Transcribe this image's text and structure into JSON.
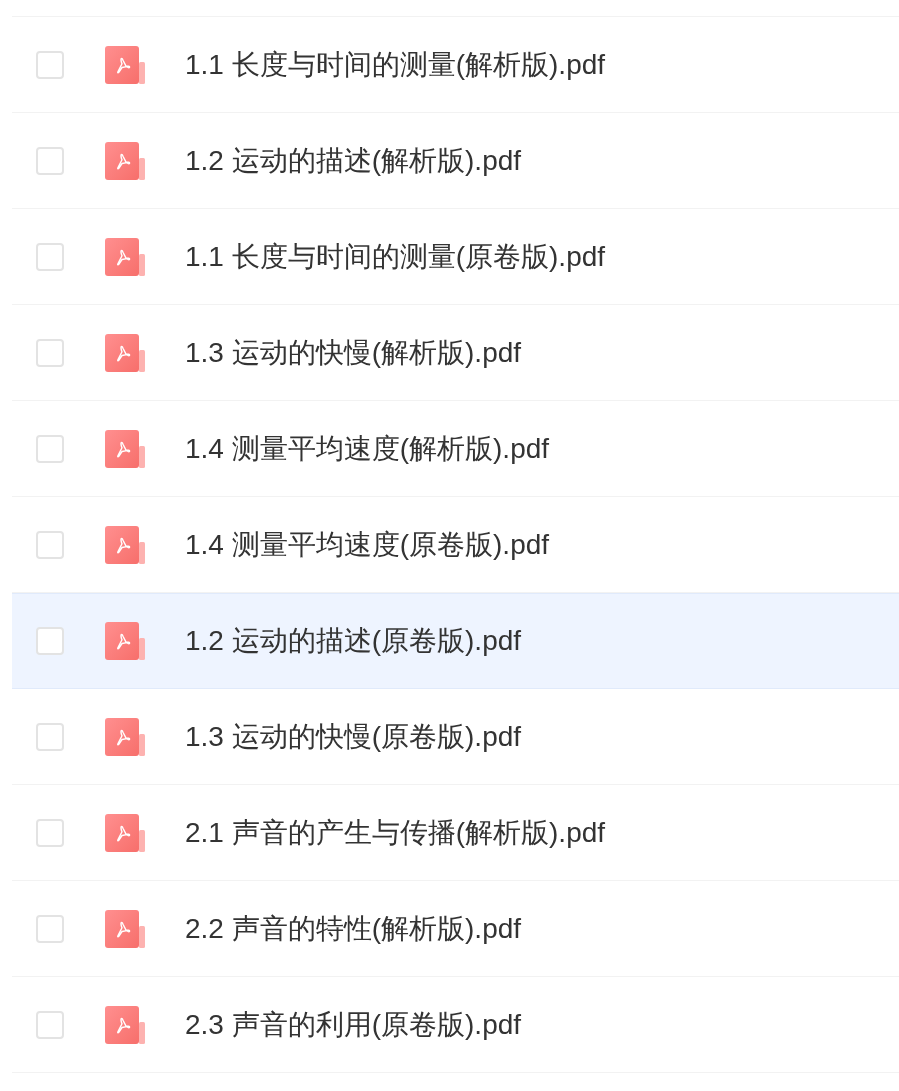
{
  "files": [
    {
      "name": "1.1 长度与时间的测量(解析版).pdf",
      "checked": false,
      "selected": false
    },
    {
      "name": "1.2 运动的描述(解析版).pdf",
      "checked": false,
      "selected": false
    },
    {
      "name": "1.1 长度与时间的测量(原卷版).pdf",
      "checked": false,
      "selected": false
    },
    {
      "name": "1.3 运动的快慢(解析版).pdf",
      "checked": false,
      "selected": false
    },
    {
      "name": "1.4 测量平均速度(解析版).pdf",
      "checked": false,
      "selected": false
    },
    {
      "name": "1.4 测量平均速度(原卷版).pdf",
      "checked": false,
      "selected": false
    },
    {
      "name": "1.2 运动的描述(原卷版).pdf",
      "checked": false,
      "selected": true
    },
    {
      "name": "1.3 运动的快慢(原卷版).pdf",
      "checked": false,
      "selected": false
    },
    {
      "name": "2.1 声音的产生与传播(解析版).pdf",
      "checked": false,
      "selected": false
    },
    {
      "name": "2.2 声音的特性(解析版).pdf",
      "checked": false,
      "selected": false
    },
    {
      "name": "2.3 声音的利用(原卷版).pdf",
      "checked": false,
      "selected": false
    }
  ]
}
